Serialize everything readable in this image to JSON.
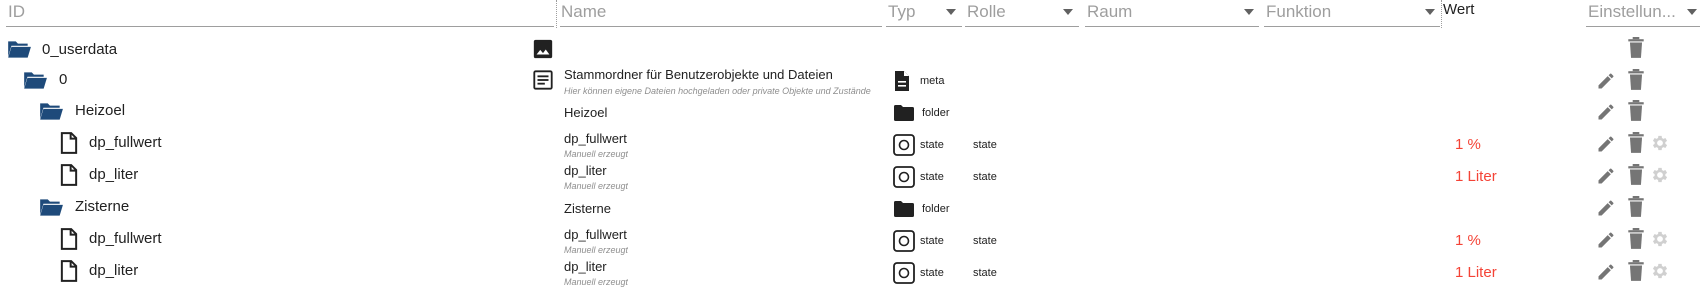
{
  "header": {
    "id_label": "ID",
    "name_label": "Name",
    "typ_label": "Typ",
    "rolle_label": "Rolle",
    "raum_label": "Raum",
    "funktion_label": "Funktion",
    "wert_label": "Wert",
    "einstellungen_label": "Einstellun..."
  },
  "rows": [
    {
      "id": "0_userdata",
      "name": "",
      "sub": "",
      "type": "",
      "role": "",
      "value": ""
    },
    {
      "id": "0",
      "name": "Stammordner für Benutzerobjekte und Dateien",
      "sub": "Hier können eigene Dateien hochgeladen oder private Objekte und Zustände",
      "type": "meta",
      "role": "",
      "value": ""
    },
    {
      "id": "Heizoel",
      "name": "Heizoel",
      "sub": "",
      "type": "folder",
      "role": "",
      "value": ""
    },
    {
      "id": "dp_fullwert",
      "name": "dp_fullwert",
      "sub": "Manuell erzeugt",
      "type": "state",
      "role": "state",
      "value": "1 %"
    },
    {
      "id": "dp_liter",
      "name": "dp_liter",
      "sub": "Manuell erzeugt",
      "type": "state",
      "role": "state",
      "value": "1 Liter"
    },
    {
      "id": "Zisterne",
      "name": "Zisterne",
      "sub": "",
      "type": "folder",
      "role": "",
      "value": ""
    },
    {
      "id": "dp_fullwert",
      "name": "dp_fullwert",
      "sub": "Manuell erzeugt",
      "type": "state",
      "role": "state",
      "value": "1 %"
    },
    {
      "id": "dp_liter",
      "name": "dp_liter",
      "sub": "Manuell erzeugt",
      "type": "state",
      "role": "state",
      "value": "1 Liter"
    }
  ],
  "colors": {
    "folder": "#1e4a7a",
    "value": "#f44336",
    "action_icon": "#757575",
    "settings_icon": "#d0d0d0"
  },
  "icons": {
    "folder_open": "folder-open-icon",
    "file": "file-icon",
    "image": "image-icon",
    "description": "description-icon",
    "meta": "meta-document-icon",
    "folder": "folder-icon",
    "state": "state-icon",
    "edit": "pencil-icon",
    "delete": "trash-icon",
    "settings": "gear-icon",
    "dropdown": "chevron-down-icon"
  }
}
